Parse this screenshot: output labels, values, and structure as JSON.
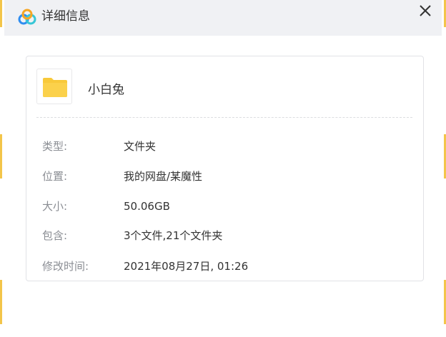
{
  "window": {
    "title": "详细信息"
  },
  "file": {
    "name": "小白兔"
  },
  "details": [
    {
      "label": "类型:",
      "value": "文件夹"
    },
    {
      "label": "位置:",
      "value": "我的网盘/某魔性"
    },
    {
      "label": "大小:",
      "value": "50.06GB"
    },
    {
      "label": "包含:",
      "value": "3个文件,21个文件夹"
    },
    {
      "label": "修改时间:",
      "value": "2021年08月27日, 01:26"
    }
  ],
  "icons": {
    "logo": "cloud-logo-icon",
    "close": "close-icon",
    "folder": "folder-icon"
  },
  "colors": {
    "folder": "#f8c93a",
    "logo_blue": "#2f8df0",
    "logo_orange": "#f6a623",
    "logo_cyan": "#37c6d6",
    "label": "#8a8d93"
  }
}
